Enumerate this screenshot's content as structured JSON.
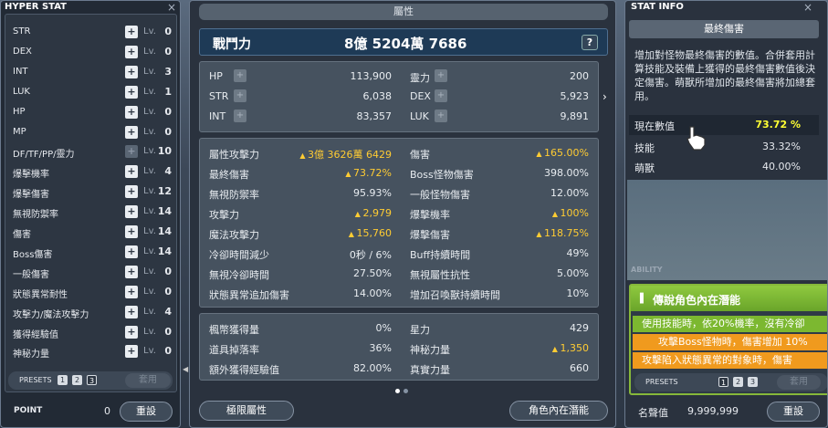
{
  "hyper_stat": {
    "title": "HYPER STAT",
    "close": "×",
    "lv_label": "Lv.",
    "rows": [
      {
        "label": "STR",
        "level": "0",
        "enabled": true
      },
      {
        "label": "DEX",
        "level": "0",
        "enabled": true
      },
      {
        "label": "INT",
        "level": "3",
        "enabled": true
      },
      {
        "label": "LUK",
        "level": "1",
        "enabled": true
      },
      {
        "label": "HP",
        "level": "0",
        "enabled": true
      },
      {
        "label": "MP",
        "level": "0",
        "enabled": true
      },
      {
        "label": "DF/TF/PP/靈力",
        "level": "10",
        "enabled": false
      },
      {
        "label": "爆擊機率",
        "level": "4",
        "enabled": true
      },
      {
        "label": "爆擊傷害",
        "level": "12",
        "enabled": true
      },
      {
        "label": "無視防禦率",
        "level": "14",
        "enabled": true
      },
      {
        "label": "傷害",
        "level": "14",
        "enabled": true
      },
      {
        "label": "Boss傷害",
        "level": "14",
        "enabled": true
      },
      {
        "label": "一般傷害",
        "level": "0",
        "enabled": true
      },
      {
        "label": "狀態異常耐性",
        "level": "0",
        "enabled": true
      },
      {
        "label": "攻擊力/魔法攻擊力",
        "level": "4",
        "enabled": true
      },
      {
        "label": "獲得經驗值",
        "level": "0",
        "enabled": true
      },
      {
        "label": "神秘力量",
        "level": "0",
        "enabled": true
      }
    ],
    "presets_label": "PRESETS",
    "presets": [
      "1",
      "2",
      "3"
    ],
    "selected_preset": "3",
    "apply_label": "套用",
    "point_label": "POINT",
    "point_value": "0",
    "reset_label": "重設"
  },
  "attributes": {
    "tab_title": "屬性",
    "combat_power_label": "戰鬥力",
    "combat_power_value": "8億 5204萬 7686",
    "help": "?",
    "basic_left": [
      {
        "k": "HP",
        "v": "113,900"
      },
      {
        "k": "STR",
        "v": "6,038"
      },
      {
        "k": "INT",
        "v": "83,357"
      }
    ],
    "basic_right": [
      {
        "k": "靈力",
        "v": "200"
      },
      {
        "k": "DEX",
        "v": "5,923"
      },
      {
        "k": "LUK",
        "v": "9,891"
      }
    ],
    "plus": "+",
    "next_arrow": "›",
    "detail_left": [
      {
        "k": "屬性攻擊力",
        "v": "3億 3626萬 6429",
        "up": true
      },
      {
        "k": "最終傷害",
        "v": "73.72%",
        "up": true
      },
      {
        "k": "無視防禦率",
        "v": "95.93%",
        "up": false
      },
      {
        "k": "攻擊力",
        "v": "2,979",
        "up": true
      },
      {
        "k": "魔法攻擊力",
        "v": "15,760",
        "up": true
      },
      {
        "k": "冷卻時間減少",
        "v": "0秒 / 6%",
        "up": false
      },
      {
        "k": "無視冷卻時間",
        "v": "27.50%",
        "up": false
      },
      {
        "k": "狀態異常追加傷害",
        "v": "14.00%",
        "up": false
      }
    ],
    "detail_right": [
      {
        "k": "傷害",
        "v": "165.00%",
        "up": true
      },
      {
        "k": "Boss怪物傷害",
        "v": "398.00%",
        "up": false
      },
      {
        "k": "一般怪物傷害",
        "v": "12.00%",
        "up": false
      },
      {
        "k": "爆擊機率",
        "v": "100%",
        "up": true
      },
      {
        "k": "爆擊傷害",
        "v": "118.75%",
        "up": true
      },
      {
        "k": "Buff持續時間",
        "v": "49%",
        "up": false
      },
      {
        "k": "無視屬性抗性",
        "v": "5.00%",
        "up": false
      },
      {
        "k": "增加召喚獸持續時間",
        "v": "10%",
        "up": false
      }
    ],
    "other_left": [
      {
        "k": "楓幣獲得量",
        "v": "0%",
        "up": false
      },
      {
        "k": "道具掉落率",
        "v": "36%",
        "up": false
      },
      {
        "k": "額外獲得經驗值",
        "v": "82.00%",
        "up": false
      }
    ],
    "other_right": [
      {
        "k": "星力",
        "v": "429",
        "up": false
      },
      {
        "k": "神秘力量",
        "v": "1,350",
        "up": true
      },
      {
        "k": "真實力量",
        "v": "660",
        "up": false
      }
    ],
    "btn_hyper": "極限屬性",
    "btn_inner": "角色內在潛能"
  },
  "stat_info": {
    "title": "STAT INFO",
    "close": "×",
    "heading": "最終傷害",
    "desc": "增加對怪物最終傷害的數值。合併套用計算技能及裝備上獲得的最終傷害數值後決定傷害。萌獸所增加的最終傷害將加總套用。",
    "rows": [
      {
        "k": "現在數值",
        "v": "73.72 %"
      },
      {
        "k": "技能",
        "v": "33.32%"
      },
      {
        "k": "萌獸",
        "v": "40.00%"
      }
    ],
    "ability_label": "ABILITY",
    "legend_title": "傳說角色內在潛能",
    "legend_icon": "▌",
    "legend_lines": [
      "使用技能時，依20%機率，沒有冷卻",
      "攻擊Boss怪物時，傷害增加 10%",
      "攻擊陷入狀態異常的對象時，傷害"
    ],
    "presets_label": "PRESETS",
    "presets": [
      "1",
      "2",
      "3"
    ],
    "selected_preset": "1",
    "apply_label": "套用",
    "honor_label": "名聲值",
    "honor_value": "9,999,999",
    "reset_label": "重設"
  },
  "colors": {
    "highlight": "#ffcc33",
    "current_value": "#ffff33",
    "legend_green": "#7cb830",
    "legend_orange": "#f09a1e"
  }
}
